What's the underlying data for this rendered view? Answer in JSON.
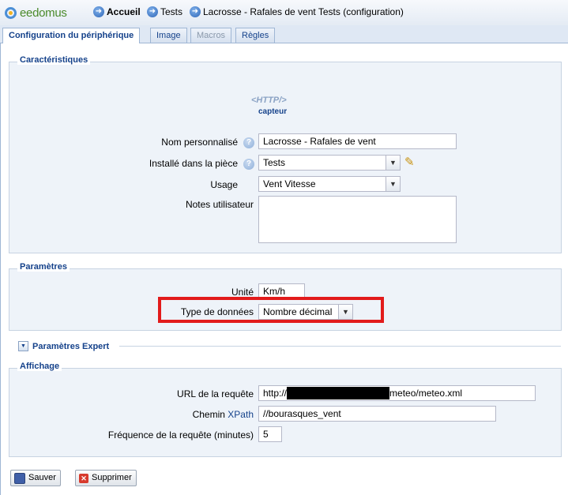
{
  "logo": {
    "text": "eedomus"
  },
  "breadcrumb": [
    {
      "label": "Accueil"
    },
    {
      "label": "Tests"
    },
    {
      "label": "Lacrosse - Rafales de vent Tests (configuration)"
    }
  ],
  "tabs": [
    {
      "label": "Configuration du périphérique",
      "state": "active"
    },
    {
      "label": "Image",
      "state": "normal"
    },
    {
      "label": "Macros",
      "state": "disabled"
    },
    {
      "label": "Règles",
      "state": "normal"
    }
  ],
  "caracteristiques": {
    "title": "Caractéristiques",
    "device_icon_text": "<HTTP/>",
    "device_caption": "capteur",
    "nom_label": "Nom personnalisé",
    "nom_value": "Lacrosse - Rafales de vent",
    "piece_label": "Installé dans la pièce",
    "piece_value": "Tests",
    "usage_label": "Usage",
    "usage_value": "Vent Vitesse",
    "notes_label": "Notes utilisateur",
    "notes_value": ""
  },
  "parametres": {
    "title": "Paramètres",
    "unite_label": "Unité",
    "unite_value": "Km/h",
    "type_label": "Type de données",
    "type_value": "Nombre décimal"
  },
  "expert": {
    "title": "Paramètres Expert"
  },
  "affichage": {
    "title": "Affichage",
    "url_label": "URL de la requête",
    "url_prefix": "http://",
    "url_suffix": "meteo/meteo.xml",
    "chemin_label_prefix": "Chemin",
    "chemin_label_link": "XPath",
    "chemin_value": "//bourasques_vent",
    "freq_label": "Fréquence de la requête (minutes)",
    "freq_value": "5"
  },
  "buttons": {
    "save": "Sauver",
    "delete": "Supprimer"
  },
  "colors": {
    "highlight": "#e21b1b",
    "accent": "#15428b"
  }
}
